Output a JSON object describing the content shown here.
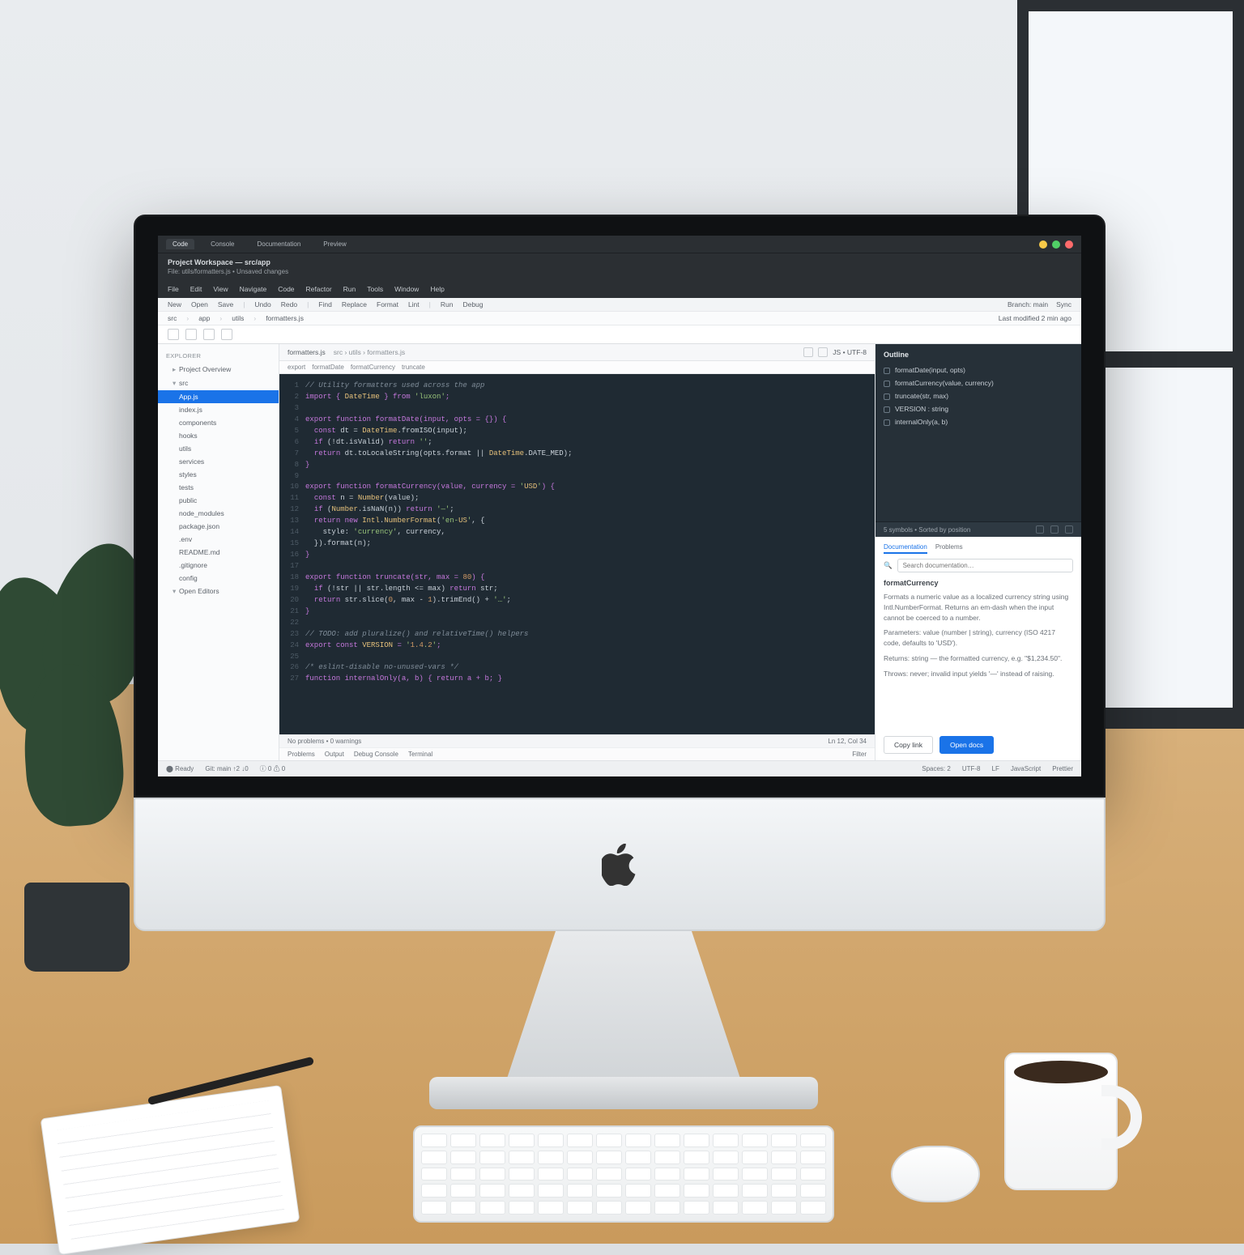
{
  "browser": {
    "tabs": [
      "Code",
      "Console",
      "Documentation",
      "Preview"
    ],
    "active_tab": 0
  },
  "app": {
    "title_line1": "Project Workspace — src/app",
    "title_line2": "File: utils/formatters.js • Unsaved changes"
  },
  "menubar": [
    "File",
    "Edit",
    "View",
    "Navigate",
    "Code",
    "Refactor",
    "Run",
    "Tools",
    "Window",
    "Help"
  ],
  "toolbar1": {
    "items": [
      "New",
      "Open",
      "Save",
      "Undo",
      "Redo",
      "Find",
      "Replace",
      "Format",
      "Lint",
      "Run",
      "Debug"
    ],
    "right": [
      "Branch: main",
      "Sync"
    ]
  },
  "toolbar2": {
    "items": [
      "src",
      "app",
      "utils",
      "formatters.js"
    ],
    "right_label": "Last modified 2 min ago"
  },
  "sidebar": {
    "groups": [
      {
        "title": "Explorer",
        "items": [
          {
            "label": "Project Overview",
            "caret": "▸"
          },
          {
            "label": "src",
            "caret": "▾"
          },
          {
            "label": "App.js",
            "active": true
          },
          {
            "label": "index.js"
          },
          {
            "label": "components"
          },
          {
            "label": "hooks"
          },
          {
            "label": "utils"
          },
          {
            "label": "services"
          },
          {
            "label": "styles"
          },
          {
            "label": "tests"
          },
          {
            "label": "public"
          },
          {
            "label": "node_modules"
          },
          {
            "label": "package.json"
          },
          {
            "label": ".env"
          },
          {
            "label": "README.md"
          },
          {
            "label": ".gitignore"
          },
          {
            "label": "config"
          },
          {
            "label": "Open Editors",
            "caret": "▾"
          }
        ]
      }
    ]
  },
  "editor": {
    "tab_label": "formatters.js",
    "crumb": "src › utils › formatters.js",
    "right_pill": "JS • UTF-8",
    "breadcrumb2": [
      "export",
      "formatDate",
      "formatCurrency",
      "truncate"
    ],
    "lines": [
      {
        "n": 1,
        "cls": "tok-cm",
        "t": "// Utility formatters used across the app"
      },
      {
        "n": 2,
        "cls": "tok-kw",
        "t": "import { DateTime } from 'luxon';"
      },
      {
        "n": 3,
        "cls": "",
        "t": ""
      },
      {
        "n": 4,
        "cls": "tok-kw",
        "t": "export function formatDate(input, opts = {}) {"
      },
      {
        "n": 5,
        "cls": "",
        "t": "  const dt = DateTime.fromISO(input);"
      },
      {
        "n": 6,
        "cls": "",
        "t": "  if (!dt.isValid) return '';"
      },
      {
        "n": 7,
        "cls": "",
        "t": "  return dt.toLocaleString(opts.format || DateTime.DATE_MED);"
      },
      {
        "n": 8,
        "cls": "tok-kw",
        "t": "}"
      },
      {
        "n": 9,
        "cls": "",
        "t": ""
      },
      {
        "n": 10,
        "cls": "tok-kw",
        "t": "export function formatCurrency(value, currency = 'USD') {"
      },
      {
        "n": 11,
        "cls": "",
        "t": "  const n = Number(value);"
      },
      {
        "n": 12,
        "cls": "",
        "t": "  if (Number.isNaN(n)) return '—';"
      },
      {
        "n": 13,
        "cls": "",
        "t": "  return new Intl.NumberFormat('en-US', {"
      },
      {
        "n": 14,
        "cls": "",
        "t": "    style: 'currency', currency,"
      },
      {
        "n": 15,
        "cls": "",
        "t": "  }).format(n);"
      },
      {
        "n": 16,
        "cls": "tok-kw",
        "t": "}"
      },
      {
        "n": 17,
        "cls": "",
        "t": ""
      },
      {
        "n": 18,
        "cls": "tok-kw",
        "t": "export function truncate(str, max = 80) {"
      },
      {
        "n": 19,
        "cls": "",
        "t": "  if (!str || str.length <= max) return str;"
      },
      {
        "n": 20,
        "cls": "",
        "t": "  return str.slice(0, max - 1).trimEnd() + '…';"
      },
      {
        "n": 21,
        "cls": "tok-kw",
        "t": "}"
      },
      {
        "n": 22,
        "cls": "",
        "t": ""
      },
      {
        "n": 23,
        "cls": "tok-cm",
        "t": "// TODO: add pluralize() and relativeTime() helpers"
      },
      {
        "n": 24,
        "cls": "tok-kw",
        "t": "export const VERSION = '1.4.2';"
      },
      {
        "n": 25,
        "cls": "",
        "t": ""
      },
      {
        "n": 26,
        "cls": "tok-cm",
        "t": "/* eslint-disable no-unused-vars */"
      },
      {
        "n": 27,
        "cls": "tok-kw",
        "t": "function internalOnly(a, b) { return a + b; }"
      }
    ],
    "status_left": "No problems  •  0 warnings",
    "status_right": "Ln 12, Col 34",
    "terminal_tabs": [
      "Problems",
      "Output",
      "Debug Console",
      "Terminal"
    ],
    "terminal_right": "Filter"
  },
  "right_panel": {
    "dark": {
      "title": "Outline",
      "items": [
        "formatDate(input, opts)",
        "formatCurrency(value, currency)",
        "truncate(str, max)",
        "VERSION : string",
        "internalOnly(a, b)"
      ],
      "footer_label": "5 symbols  •  Sorted by position"
    },
    "light": {
      "tabs": [
        "Documentation",
        "Problems"
      ],
      "active_tab": 0,
      "search_placeholder": "Search documentation…",
      "heading": "formatCurrency",
      "paragraphs": [
        "Formats a numeric value as a localized currency string using Intl.NumberFormat. Returns an em-dash when the input cannot be coerced to a number.",
        "Parameters: value (number | string), currency (ISO 4217 code, defaults to 'USD').",
        "Returns: string — the formatted currency, e.g. \"$1,234.50\".",
        "Throws: never; invalid input yields '—' instead of raising."
      ],
      "btn_secondary": "Copy link",
      "btn_primary": "Open docs"
    }
  },
  "statusbar": {
    "items_left": [
      "⬤ Ready",
      "Git: main ↑2 ↓0",
      "ⓘ 0  ⚠ 0"
    ],
    "items_right": [
      "Spaces: 2",
      "UTF-8",
      "LF",
      "JavaScript",
      "Prettier"
    ]
  }
}
